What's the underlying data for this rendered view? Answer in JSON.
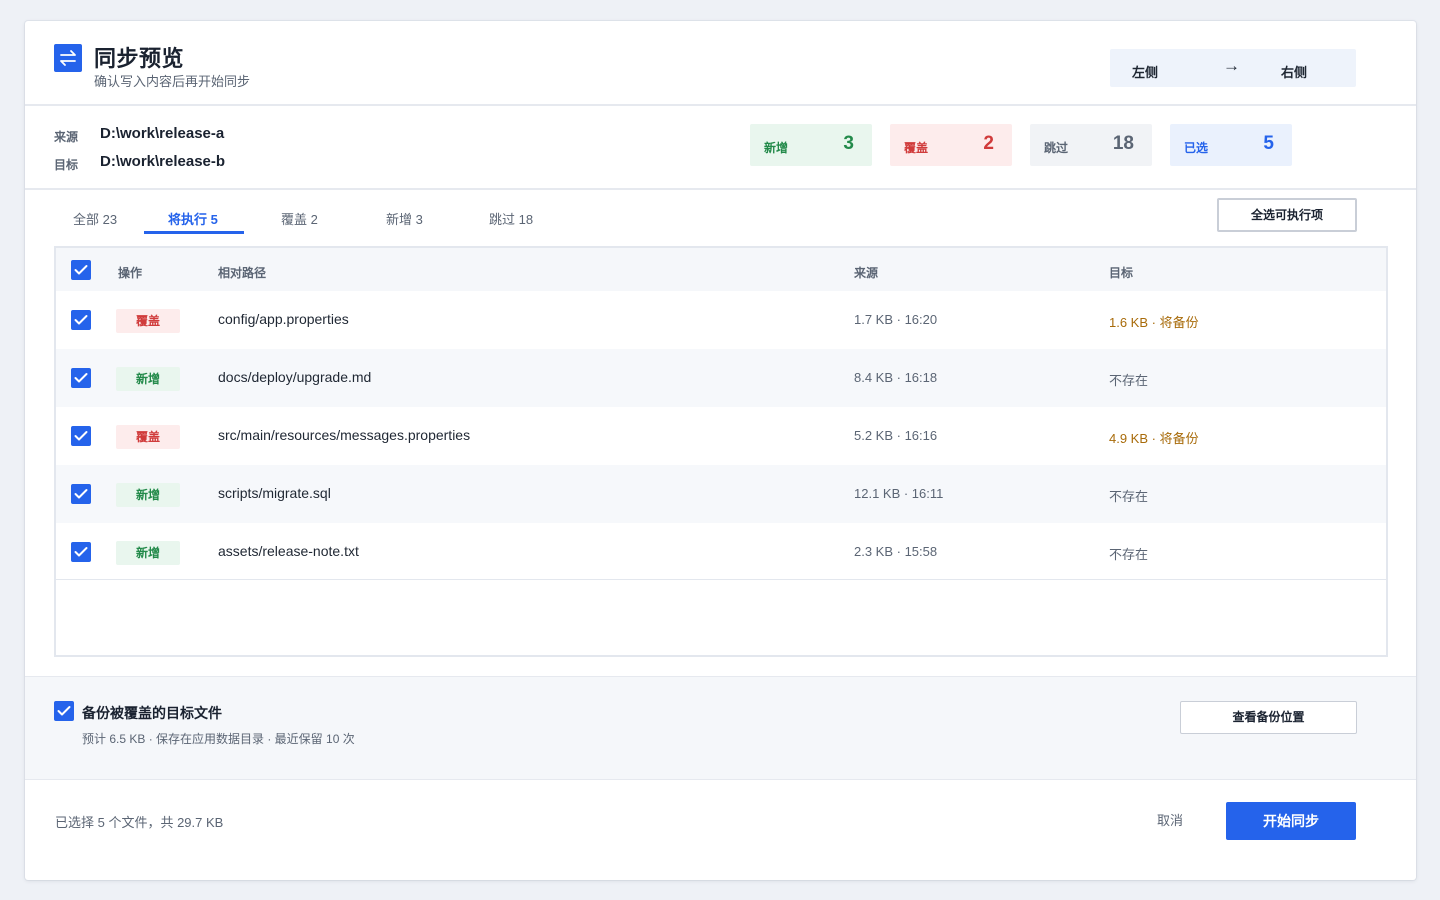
{
  "header": {
    "title": "同步预览",
    "subtitle": "确认写入内容后再开始同步",
    "direction": {
      "left": "左侧",
      "arrow": "→",
      "right": "右侧"
    }
  },
  "paths": {
    "source_label": "来源",
    "source_value": "D:\\work\\release-a",
    "target_label": "目标",
    "target_value": "D:\\work\\release-b"
  },
  "stats": [
    {
      "label": "新增",
      "value": "3",
      "color": "#238a4a",
      "bg": "#e9f6ee"
    },
    {
      "label": "覆盖",
      "value": "2",
      "color": "#d03b3b",
      "bg": "#fdecec"
    },
    {
      "label": "跳过",
      "value": "18",
      "color": "#5b6574",
      "bg": "#f1f3f6"
    },
    {
      "label": "已选",
      "value": "5",
      "color": "#2563eb",
      "bg": "#eaf1fd"
    }
  ],
  "tabs": [
    {
      "label": "全部 23",
      "active": false
    },
    {
      "label": "将执行 5",
      "active": true
    },
    {
      "label": "覆盖 2",
      "active": false
    },
    {
      "label": "新增 3",
      "active": false
    },
    {
      "label": "跳过 18",
      "active": false
    }
  ],
  "select_all_exec_label": "全选可执行项",
  "table": {
    "headers": {
      "action": "操作",
      "path": "相对路径",
      "source": "来源",
      "target": "目标"
    },
    "rows": [
      {
        "action": "覆盖",
        "type": "overwrite",
        "path": "config/app.properties",
        "source": "1.7 KB · 16:20",
        "target": "1.6 KB · 将备份",
        "target_warn": true,
        "checked": true
      },
      {
        "action": "新增",
        "type": "add",
        "path": "docs/deploy/upgrade.md",
        "source": "8.4 KB · 16:18",
        "target": "不存在",
        "target_warn": false,
        "checked": true
      },
      {
        "action": "覆盖",
        "type": "overwrite",
        "path": "src/main/resources/messages.properties",
        "source": "5.2 KB · 16:16",
        "target": "4.9 KB · 将备份",
        "target_warn": true,
        "checked": true
      },
      {
        "action": "新增",
        "type": "add",
        "path": "scripts/migrate.sql",
        "source": "12.1 KB · 16:11",
        "target": "不存在",
        "target_warn": false,
        "checked": true
      },
      {
        "action": "新增",
        "type": "add",
        "path": "assets/release-note.txt",
        "source": "2.3 KB · 15:58",
        "target": "不存在",
        "target_warn": false,
        "checked": true
      }
    ]
  },
  "backup": {
    "checked": true,
    "title": "备份被覆盖的目标文件",
    "description": "预计 6.5 KB · 保存在应用数据目录 · 最近保留 10 次",
    "view_button": "查看备份位置"
  },
  "footer": {
    "summary": "已选择 5 个文件，共 29.7 KB",
    "cancel": "取消",
    "start": "开始同步"
  },
  "colors": {
    "accent": "#2563eb",
    "warn": "#a86b0a"
  }
}
